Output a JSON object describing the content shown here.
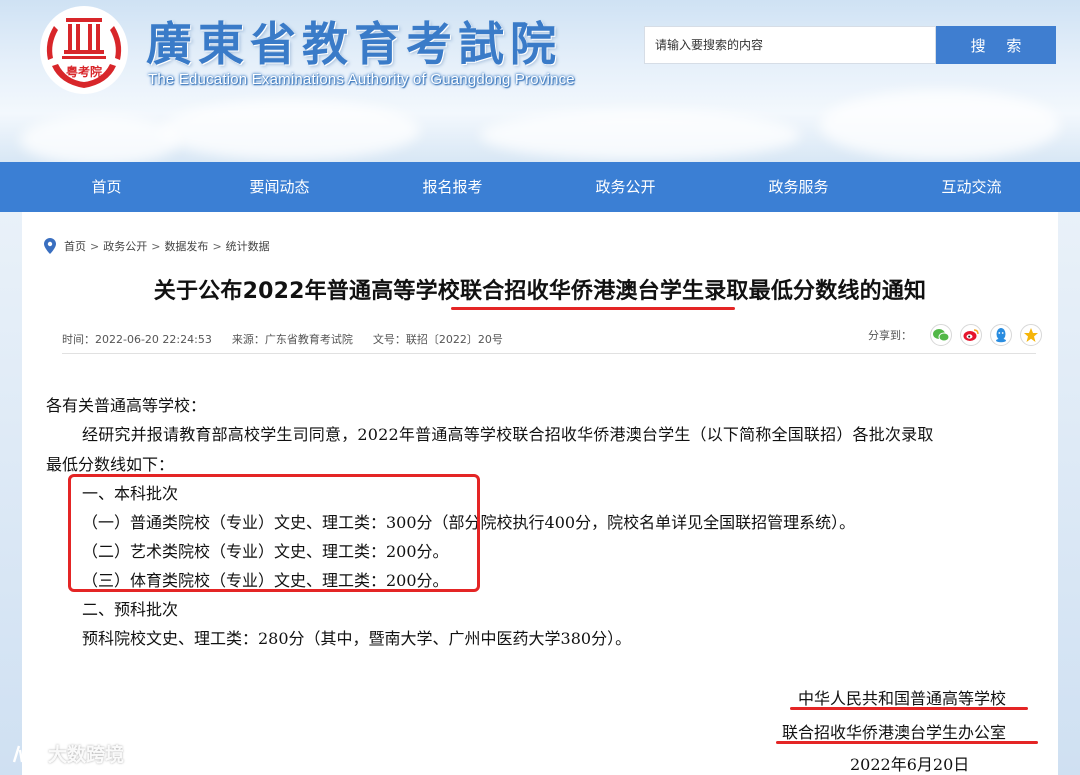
{
  "header": {
    "site_title": "廣東省教育考試院",
    "site_subtitle": "The Education Examinations Authority of Guangdong Province",
    "logo_text": "粤考院",
    "search_placeholder": "请输入要搜索的内容",
    "search_button": "搜 索"
  },
  "nav": {
    "items": [
      "首页",
      "要闻动态",
      "报名报考",
      "政务公开",
      "政务服务",
      "互动交流"
    ]
  },
  "breadcrumb": {
    "items": [
      "首页",
      "政务公开",
      "数据发布",
      "统计数据"
    ],
    "separator": ">"
  },
  "article": {
    "title": "关于公布2022年普通高等学校联合招收华侨港澳台学生录取最低分数线的通知",
    "meta": {
      "time": "时间：2022-06-20 22:24:53",
      "source": "来源：广东省教育考试院",
      "doc_no": "文号：联招〔2022〕20号"
    },
    "share_label": "分享到：",
    "share_icons": [
      "wechat-icon",
      "weibo-icon",
      "qq-icon",
      "qzone-icon"
    ],
    "salutation": "各有关普通高等学校：",
    "intro_line1": "经研究并报请教育部高校学生司同意，2022年普通高等学校联合招收华侨港澳台学生（以下简称全国联招）各批次录取",
    "intro_line2": "最低分数线如下：",
    "sections": [
      {
        "heading": "一、本科批次",
        "lines": [
          "（一）普通类院校（专业）文史、理工类：300分（部分院校执行400分，院校名单详见全国联招管理系统）。",
          "（二）艺术类院校（专业）文史、理工类：200分。",
          "（三）体育类院校（专业）文史、理工类：200分。"
        ]
      },
      {
        "heading": "二、预科批次",
        "lines": [
          "预科院校文史、理工类：280分（其中，暨南大学、广州中医药大学380分）。"
        ]
      }
    ],
    "signature": {
      "line1": "中华人民共和国普通高等学校",
      "line2": "联合招收华侨港澳台学生办公室",
      "date": "2022年6月20日"
    }
  },
  "watermark": "大数跨境",
  "colors": {
    "nav_bg": "#3b7fd4",
    "search_btn": "#3f7ed0",
    "highlight_red": "#e42525"
  }
}
